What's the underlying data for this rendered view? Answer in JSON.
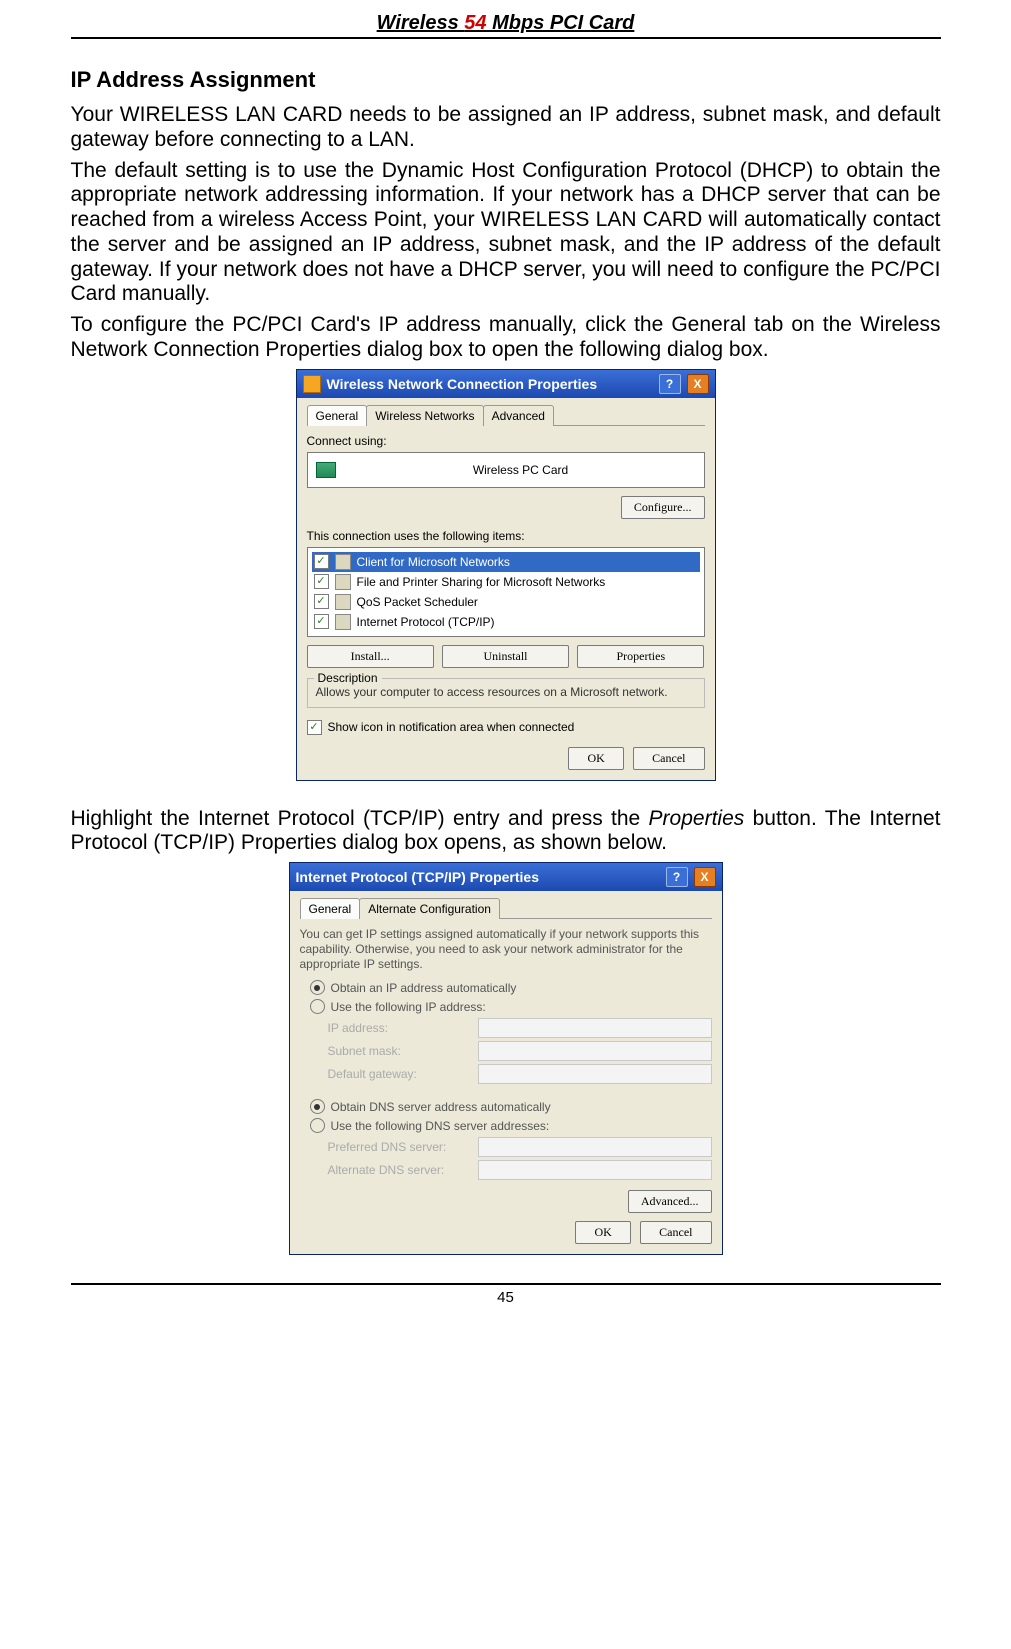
{
  "header": {
    "prefix": "Wireless ",
    "red": "54",
    "suffix": " Mbps PCI Card"
  },
  "section_head": "IP Address Assignment",
  "para1": "Your WIRELESS LAN CARD needs to be assigned an IP address, subnet mask, and default gateway before connecting to a LAN.",
  "para2": "The default setting is to use the Dynamic Host Configuration Protocol (DHCP) to obtain the appropriate network addressing information.  If your network has a DHCP server that can be reached from a wireless Access Point, your WIRELESS LAN CARD will automatically contact the server and be assigned an IP address, subnet mask, and the IP address of the default gateway.  If your network does not have a DHCP server, you will need to configure the PC/PCI Card manually.",
  "para3": "To configure the PC/PCI Card's IP address manually, click the General tab on the Wireless Network Connection Properties dialog box to open the following dialog box.",
  "para4_a": "Highlight the Internet Protocol (TCP/IP) entry and press the ",
  "para4_ital": "Properties",
  "para4_b": " button.  The Internet Protocol (TCP/IP) Properties dialog box opens, as shown below.",
  "dialog1": {
    "title": "Wireless Network Connection Properties",
    "tabs": [
      "General",
      "Wireless Networks",
      "Advanced"
    ],
    "connect_label": "Connect using:",
    "adapter_name": "Wireless PC Card",
    "configure_btn": "Configure...",
    "items_label": "This connection uses the following items:",
    "items": [
      "Client for Microsoft Networks",
      "File and Printer Sharing for Microsoft Networks",
      "QoS Packet Scheduler",
      "Internet Protocol (TCP/IP)"
    ],
    "install_btn": "Install...",
    "uninstall_btn": "Uninstall",
    "properties_btn": "Properties",
    "desc_group": "Description",
    "desc_text": "Allows your computer to access resources on a Microsoft network.",
    "show_icon": "Show icon in notification area when connected",
    "ok": "OK",
    "cancel": "Cancel"
  },
  "dialog2": {
    "title": "Internet Protocol (TCP/IP) Properties",
    "tabs": [
      "General",
      "Alternate Configuration"
    ],
    "info": "You can get IP settings assigned automatically if your network supports this capability. Otherwise, you need to ask your network administrator for the appropriate IP settings.",
    "r1": "Obtain an IP address automatically",
    "r2": "Use the following IP address:",
    "ip": "IP address:",
    "mask": "Subnet mask:",
    "gw": "Default gateway:",
    "r3": "Obtain DNS server address automatically",
    "r4": "Use the following DNS server addresses:",
    "dns1": "Preferred DNS server:",
    "dns2": "Alternate DNS server:",
    "advanced": "Advanced...",
    "ok": "OK",
    "cancel": "Cancel"
  },
  "page_number": "45"
}
